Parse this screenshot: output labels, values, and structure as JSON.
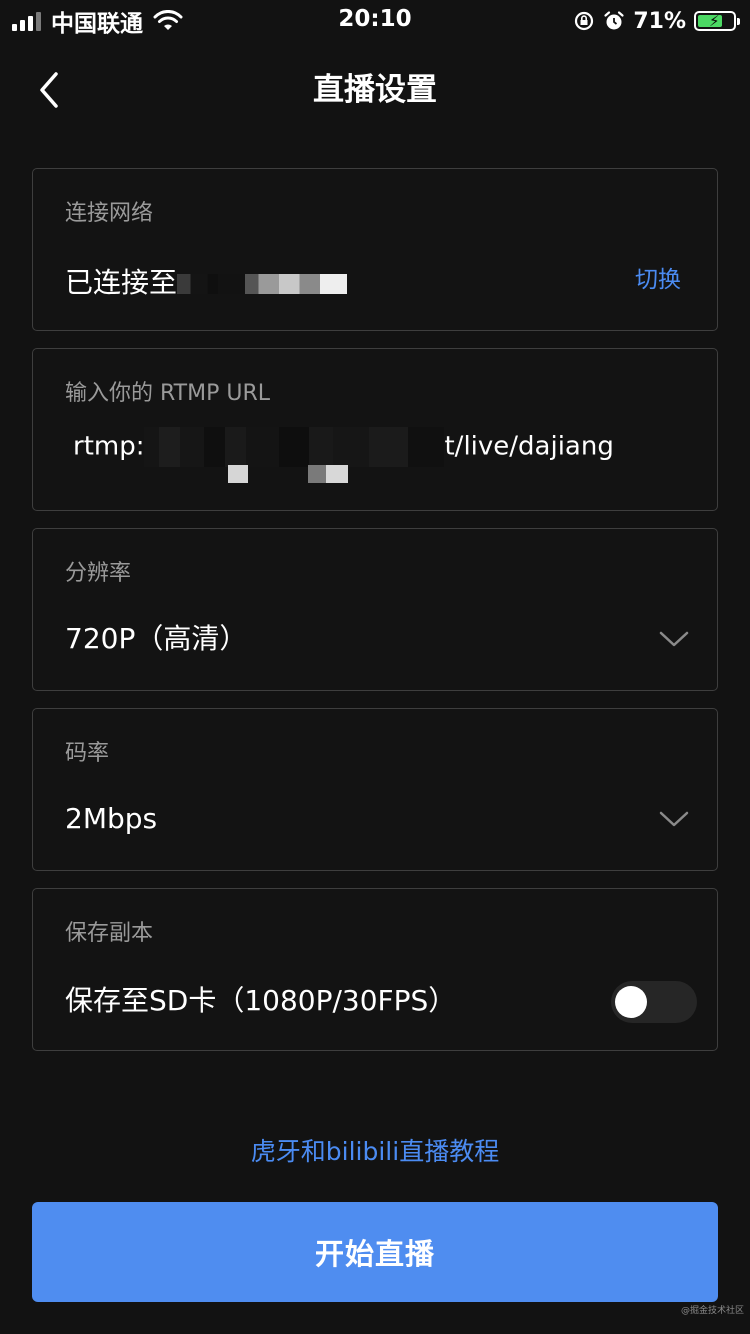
{
  "status_bar": {
    "carrier": "中国联通",
    "time": "20:10",
    "battery_percent": "71%",
    "battery_level": 0.71,
    "icons": [
      "cellular-signal-icon",
      "wifi-icon",
      "screen-lock-icon",
      "alarm-icon",
      "battery-charging-icon"
    ]
  },
  "nav": {
    "title": "直播设置",
    "back_icon": "chevron-left-icon"
  },
  "network": {
    "label": "连接网络",
    "value": "已连接至",
    "switch_label": "切换"
  },
  "rtmp": {
    "label": "输入你的 RTMP URL",
    "url_prefix": "rtmp:",
    "url_suffix": "t/live/dajiang"
  },
  "resolution": {
    "label": "分辨率",
    "value": "720P（高清）"
  },
  "bitrate": {
    "label": "码率",
    "value": "2Mbps"
  },
  "save_copy": {
    "label": "保存副本",
    "option": "保存至SD卡（1080P/30FPS）",
    "enabled": false
  },
  "tutorial_link": "虎牙和bilibili直播教程",
  "start_button": "开始直播",
  "watermark": "@掘金技术社区",
  "colors": {
    "background": "#121212",
    "card_border": "#3e3e3e",
    "accent": "#4f8df0",
    "link": "#4b8bf2",
    "label": "#9a9a9a"
  }
}
